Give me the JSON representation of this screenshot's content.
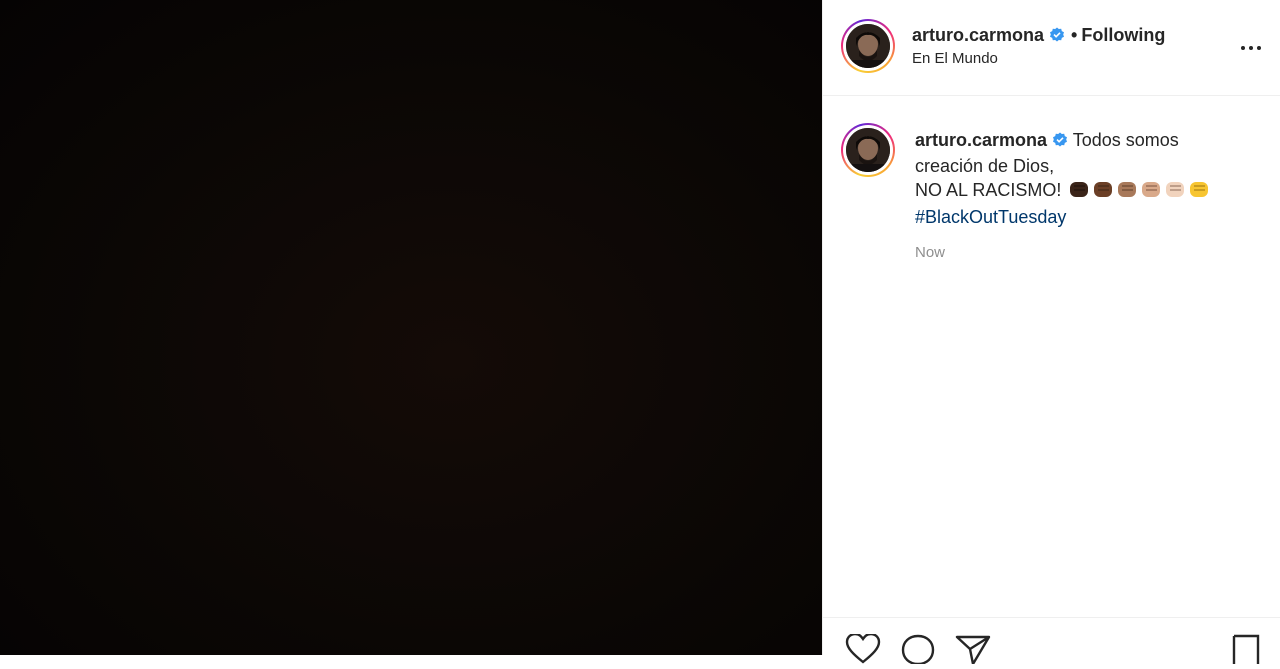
{
  "post": {
    "media_color": "#0b0705"
  },
  "header": {
    "username": "arturo.carmona",
    "separator": "•",
    "follow_status": "Following",
    "location": "En El Mundo",
    "icons": {
      "verified": "verified-badge-icon",
      "more": "more-options-icon"
    }
  },
  "caption": {
    "username": "arturo.carmona",
    "line1": "Todos somos creación de Dios,",
    "line2": "NO AL RACISMO!",
    "emoji": [
      "fist-dark",
      "fist-medium-dark",
      "fist-medium",
      "fist-medium-light",
      "fist-light",
      "fist-yellow"
    ],
    "hashtag": "#BlackOutTuesday",
    "timestamp": "Now"
  },
  "actions": {
    "icons": [
      "heart-icon",
      "comment-icon",
      "share-icon",
      "bookmark-icon"
    ]
  },
  "colors": {
    "link": "#00376b",
    "verified": "#3897f0",
    "muted": "#8e8e8e"
  }
}
